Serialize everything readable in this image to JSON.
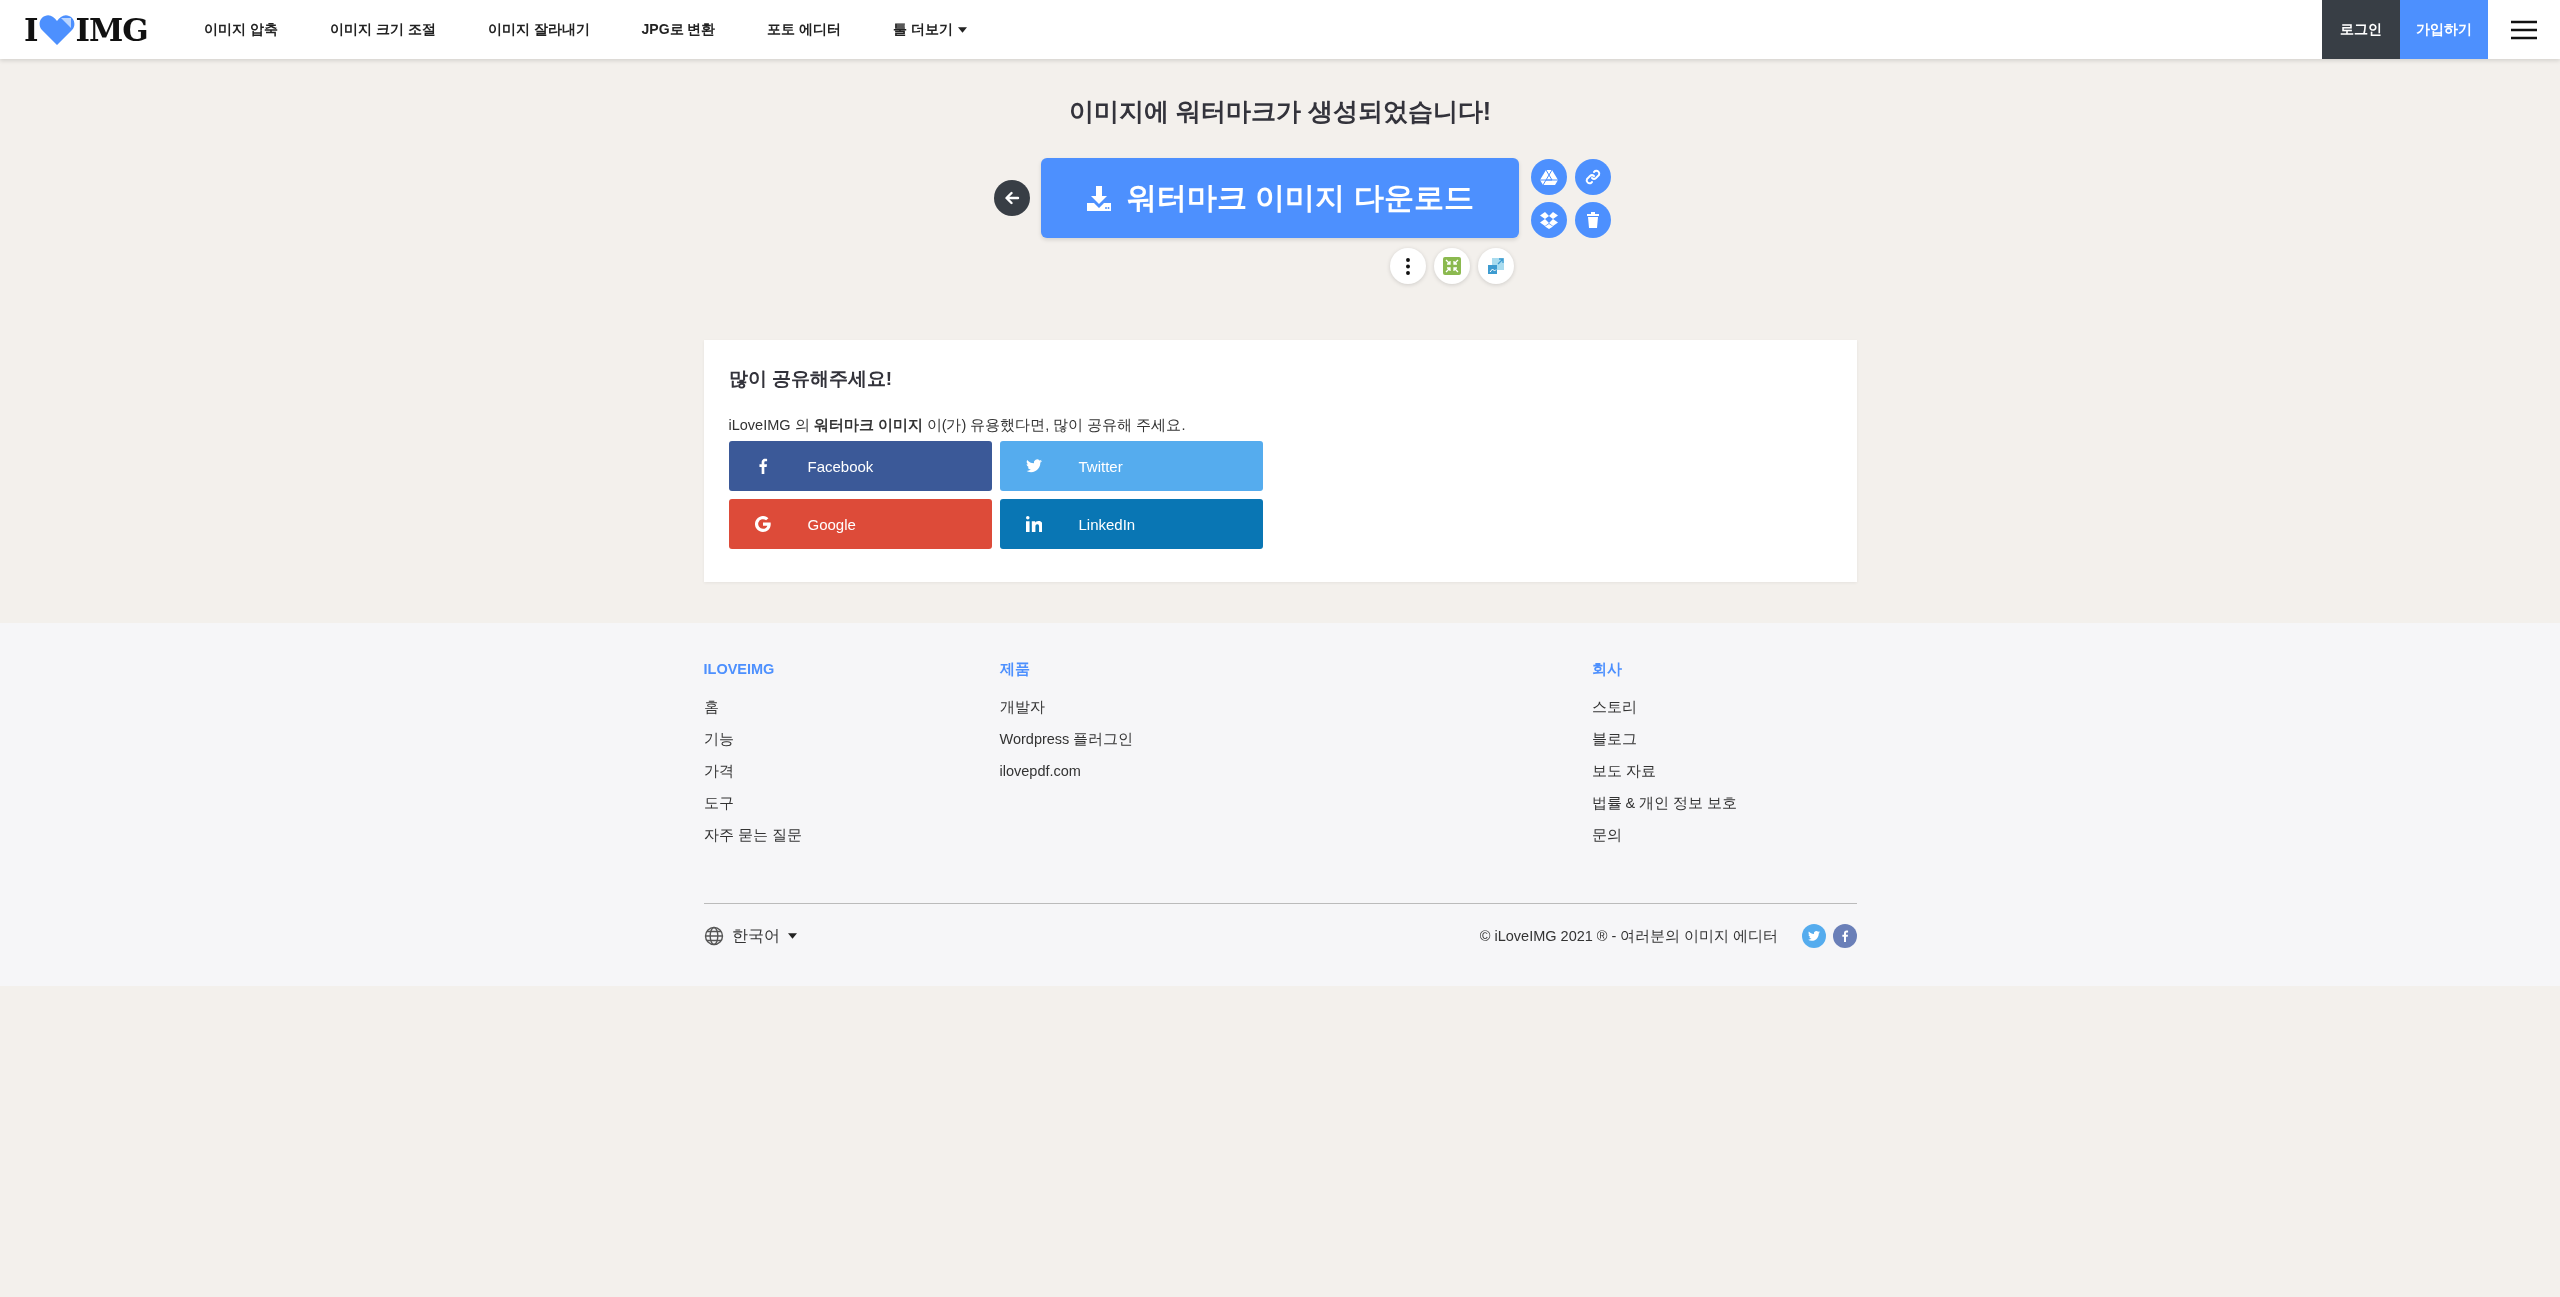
{
  "logo": {
    "left": "I",
    "right": "IMG"
  },
  "nav": [
    {
      "label": "이미지 압축",
      "kind": "link"
    },
    {
      "label": "이미지 크기 조절",
      "kind": "link"
    },
    {
      "label": "이미지 잘라내기",
      "kind": "link"
    },
    {
      "label": "JPG로 변환",
      "kind": "link"
    },
    {
      "label": "포토 에디터",
      "kind": "link"
    },
    {
      "label": "툴 더보기",
      "kind": "dropdown"
    }
  ],
  "auth": {
    "login": "로그인",
    "signup": "가입하기"
  },
  "title": "이미지에 워터마크가 생성되었습니다!",
  "download_button": "워터마크 이미지 다운로드",
  "share": {
    "title": "많이 공유해주세요!",
    "text": "iLoveIMG 의 **워터마크 이미지** 이(가) 유용했다면, 많이 공유해 주세요.",
    "buttons": [
      {
        "kind": "facebook",
        "label": "Facebook",
        "color": "#3b5998"
      },
      {
        "kind": "twitter",
        "label": "Twitter",
        "color": "#55acee"
      },
      {
        "kind": "google",
        "label": "Google",
        "color": "#dd4b39"
      },
      {
        "kind": "linkedin",
        "label": "LinkedIn",
        "color": "#0976b4"
      }
    ]
  },
  "footer": {
    "columns": [
      {
        "heading": "ILOVEIMG",
        "links": [
          "홈",
          "기능",
          "가격",
          "도구",
          "자주 묻는 질문"
        ]
      },
      {
        "heading": "제품",
        "links": [
          "개발자",
          "Wordpress 플러그인",
          "ilovepdf.com"
        ]
      },
      {
        "heading": "회사",
        "links": [
          "스토리",
          "블로그",
          "보도 자료",
          "법률 & 개인 정보 보호",
          "문의"
        ]
      }
    ],
    "language": "한국어",
    "copyright": "© iLoveIMG 2021 ® - 여러분의 이미지 에디터"
  }
}
